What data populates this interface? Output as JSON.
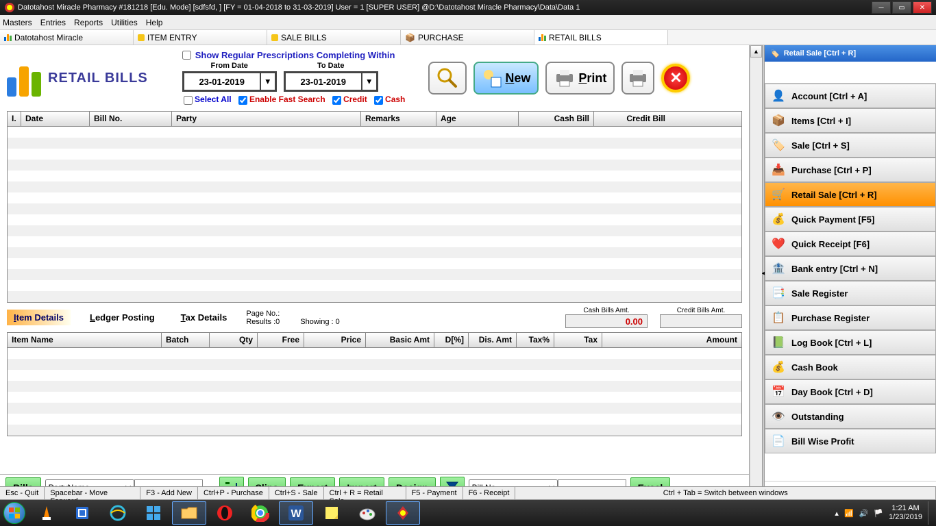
{
  "titlebar": {
    "text": "Datotahost Miracle Pharmacy #181218  [Edu. Mode]  [sdfsfd, ]  [FY = 01-04-2018 to 31-03-2019] User = 1 [SUPER USER]  @D:\\Datotahost Miracle Pharmacy\\Data\\Data 1"
  },
  "menu": {
    "items": [
      "Masters",
      "Entries",
      "Reports",
      "Utilities",
      "Help"
    ]
  },
  "mditabs": {
    "tabs": [
      "Datotahost Miracle",
      "ITEM ENTRY",
      "SALE BILLS",
      "PURCHASE",
      "RETAIL BILLS"
    ]
  },
  "page": {
    "title": "RETAIL BILLS",
    "show_regular_label": "Show Regular Prescriptions Completing Within",
    "from_label": "From Date",
    "to_label": "To Date",
    "from_date": "23-01-2019",
    "to_date": "23-01-2019",
    "select_all": "Select All",
    "enable_fast": "Enable Fast Search",
    "credit": "Credit",
    "cash": "Cash",
    "new": "New",
    "print": "Print"
  },
  "grid_main": {
    "cols": [
      "I.",
      "Date",
      "Bill No.",
      "Party",
      "Remarks",
      "Age",
      "Cash Bill",
      "Credit Bill"
    ]
  },
  "subtabs": {
    "item_details": "Item Details",
    "ledger": "Ledger Posting",
    "tax": "Tax Details",
    "page_no": "Page No.:",
    "results": "Results :0",
    "showing": "Showing :   0",
    "cash_label": "Cash Bills Amt.",
    "credit_label": "Credit Bills Amt.",
    "cash_amt": "0.00",
    "credit_amt": ""
  },
  "grid_items": {
    "cols": [
      "Item Name",
      "Batch",
      "Qty",
      "Free",
      "Price",
      "Basic Amt",
      "D[%]",
      "Dis. Amt",
      "Tax%",
      "Tax",
      "Amount"
    ]
  },
  "actions": {
    "bills": "Bills",
    "party_combo": "PartyName",
    "slips": "Slips",
    "export": "Export",
    "import": "Import",
    "design": "Design",
    "billno_combo": "Bill No.",
    "excel": "Excel"
  },
  "shortcuts": [
    "Esc - Quit",
    "Spacebar - Move Forward",
    "F3 - Add New",
    "Ctrl+P - Purchase",
    "Ctrl+S - Sale",
    "Ctrl + R = Retail Sale",
    "F5 - Payment",
    "F6 - Receipt",
    "Ctrl + Tab = Switch between windows"
  ],
  "rightpanel": {
    "title": "Retail Sale [Ctrl + R]",
    "items": [
      {
        "label": "Account [Ctrl + A]",
        "color": "#e67e22"
      },
      {
        "label": "Items [Ctrl + I]",
        "color": "#888"
      },
      {
        "label": "Sale [Ctrl + S]",
        "color": "#c00"
      },
      {
        "label": "Purchase [Ctrl + P]",
        "color": "#a52"
      },
      {
        "label": "Retail Sale [Ctrl + R]",
        "color": "#c40",
        "selected": true
      },
      {
        "label": "Quick Payment [F5]",
        "color": "#c40"
      },
      {
        "label": "Quick Receipt [F6]",
        "color": "#c00"
      },
      {
        "label": "Bank entry [Ctrl + N]",
        "color": "#555"
      },
      {
        "label": "Sale Register",
        "color": "#c80"
      },
      {
        "label": "Purchase Register",
        "color": "#888"
      },
      {
        "label": "Log Book [Ctrl + L]",
        "color": "#2a8"
      },
      {
        "label": "Cash Book",
        "color": "#cc9"
      },
      {
        "label": "Day Book [Ctrl + D]",
        "color": "#bbb"
      },
      {
        "label": "Outstanding",
        "color": "#333"
      },
      {
        "label": "Bill Wise Profit",
        "color": "#ddd"
      }
    ]
  },
  "systray": {
    "time": "1:21 AM",
    "date": "1/23/2019"
  }
}
